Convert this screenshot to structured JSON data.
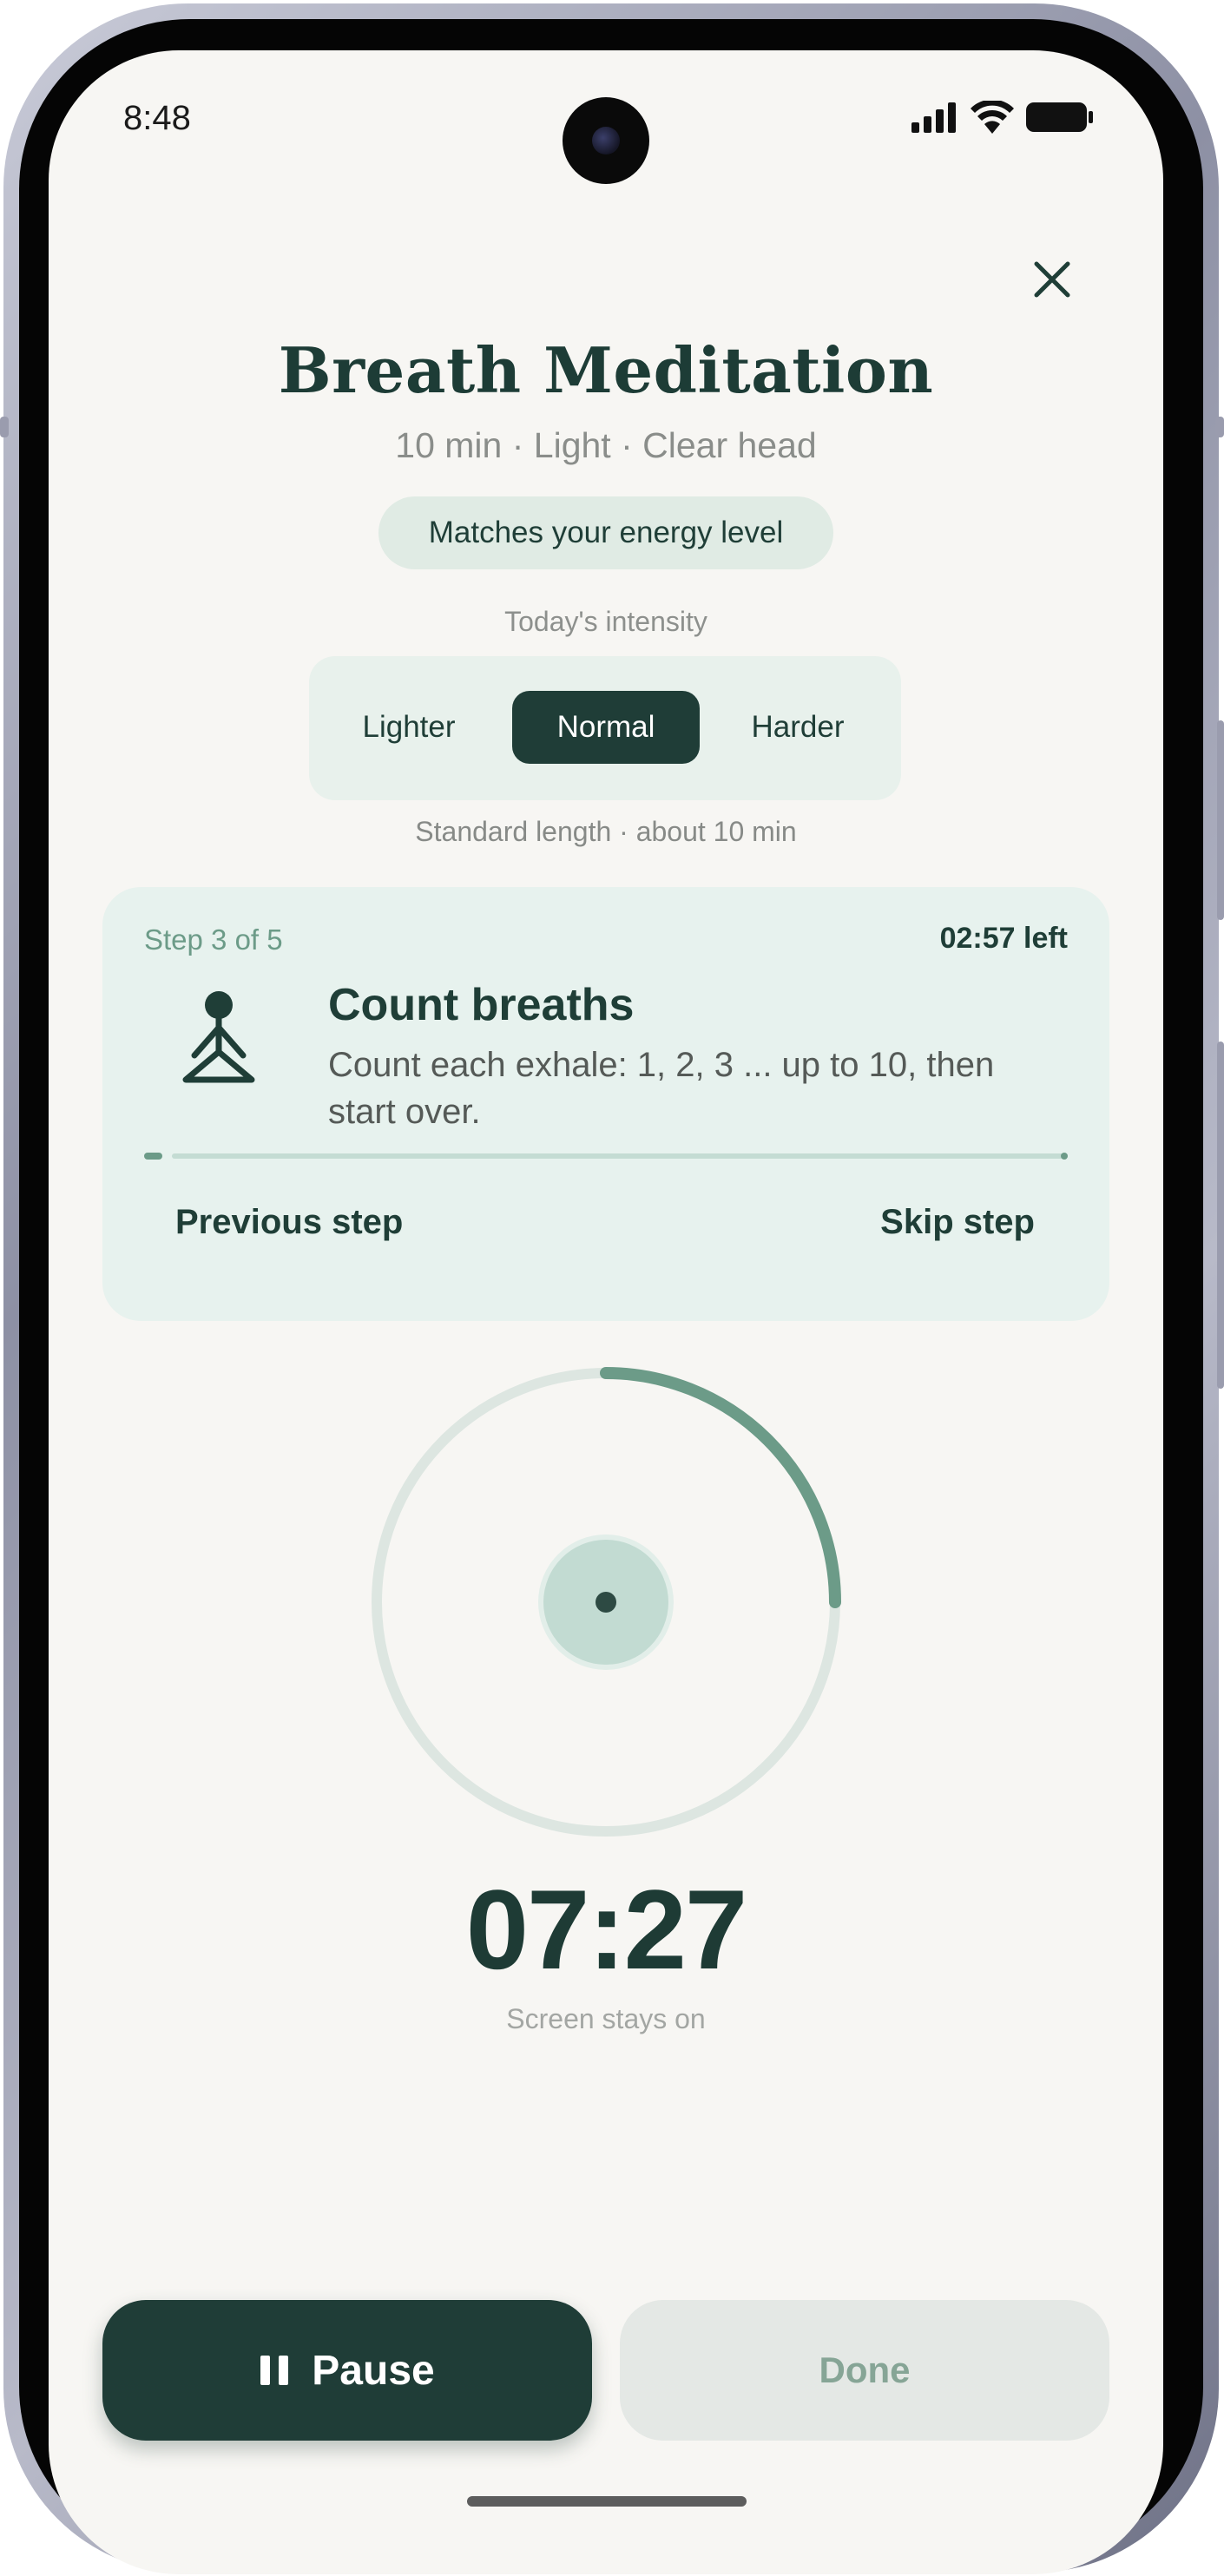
{
  "status_bar": {
    "time": "8:48"
  },
  "header": {
    "title": "Breath Meditation",
    "subtitle": "10 min · Light · Clear head",
    "badge": "Matches your energy level"
  },
  "intensity": {
    "label": "Today's intensity",
    "options": [
      "Lighter",
      "Normal",
      "Harder"
    ],
    "selected": "Normal",
    "note": "Standard length · about 10 min"
  },
  "step": {
    "counter": "Step 3 of 5",
    "time_left": "02:57 left",
    "title": "Count breaths",
    "description": "Count each exhale: 1, 2, 3 ... up to 10, then start over.",
    "progress_fraction": 0.02,
    "previous_label": "Previous step",
    "skip_label": "Skip step"
  },
  "timer": {
    "display": "07:27",
    "ring_progress_fraction": 0.25,
    "note": "Screen stays on"
  },
  "actions": {
    "pause_label": "Pause",
    "done_label": "Done"
  },
  "colors": {
    "accent_dark": "#1f3d37",
    "accent_green": "#6c9b88",
    "card_bg": "#e7f2ee",
    "screen_bg": "#f7f6f3"
  },
  "icons": [
    "close-icon",
    "meditation-icon",
    "pause-icon",
    "signal-icon",
    "wifi-icon",
    "battery-icon"
  ]
}
